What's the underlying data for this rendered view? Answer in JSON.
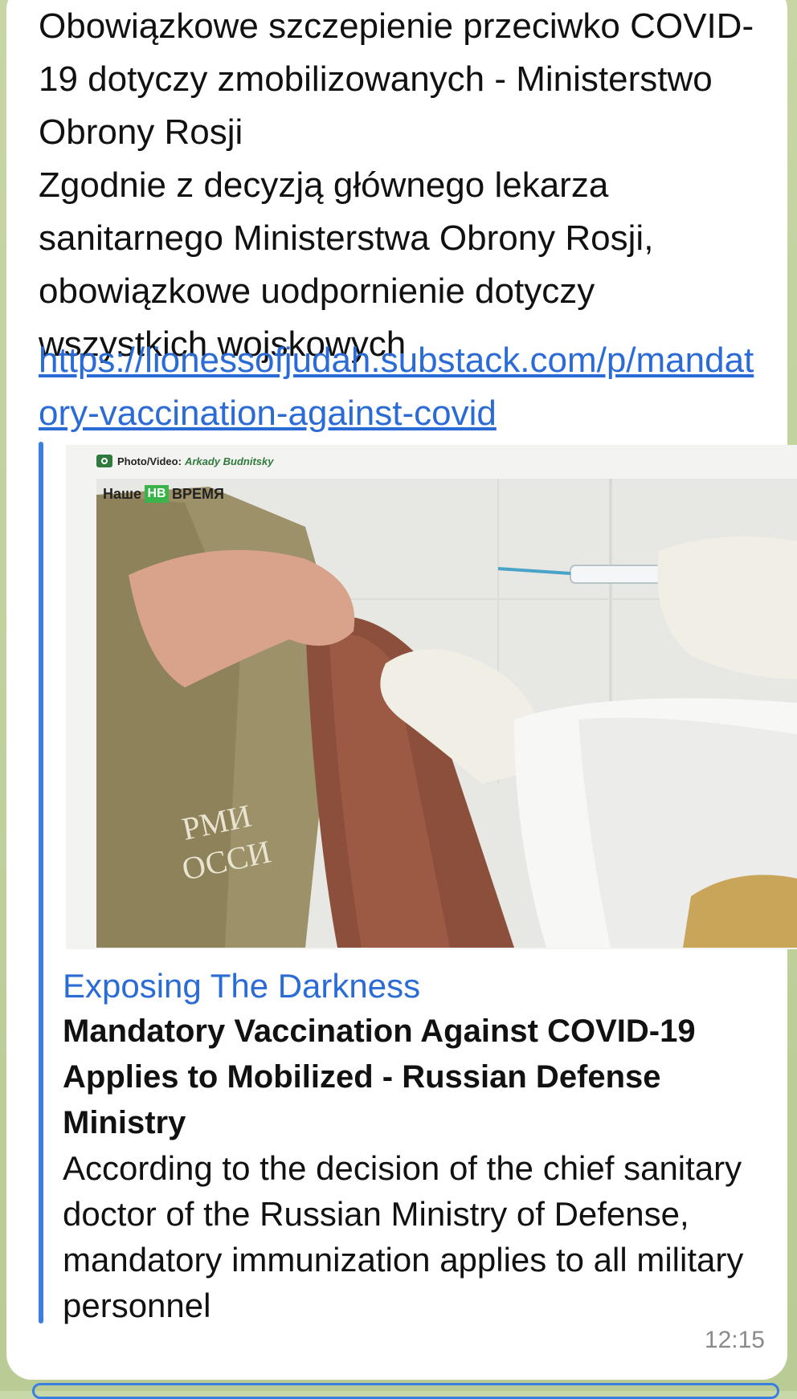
{
  "message": {
    "text": "Obowiązkowe szczepienie przeciwko COVID-19 dotyczy zmobilizowanych - Ministerstwo Obrony Rosji\nZgodnie z decyzją głównego lekarza sanitarnego Ministerstwa Obrony Rosji, obowiązkowe uodpornienie dotyczy wszystkich wojskowych",
    "link": "https://lionessofjudah.substack.com/p/mandatory-vaccination-against-covid",
    "time": "12:15"
  },
  "preview": {
    "photo_credit_label": "Photo/Video:",
    "photo_credit_name": "Arkady Budnitsky",
    "photo_logo_left": "Наше",
    "photo_logo_mid": "НВ",
    "photo_logo_right": "ВРЕМЯ",
    "site_name": "Exposing The Darkness",
    "title": "Mandatory Vaccination Against COVID-19 Applies to Mobilized - Russian Defense Ministry",
    "description": "According to the decision of the chief sanitary doctor of the Russian Ministry of Defense, mandatory immunization applies to all military personnel"
  },
  "colors": {
    "link": "#2a6bd6",
    "accent_bar": "#3a7ee0",
    "bubble": "#ffffff",
    "chat_background": "#c7d6a4"
  }
}
